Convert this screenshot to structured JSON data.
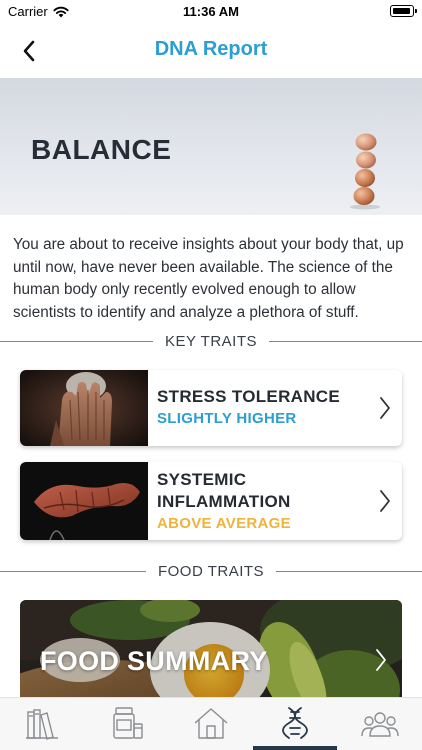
{
  "status": {
    "carrier": "Carrier",
    "time": "11:36 AM"
  },
  "nav": {
    "title": "DNA Report"
  },
  "hero": {
    "title": "BALANCE"
  },
  "intro_text": "You are about to receive insights about your body that, up until now, have never been available. The science of the human body only recently evolved enough to allow scientists to identify and analyze a plethora of stuff.",
  "sections": {
    "key_traits": "KEY TRAITS",
    "food_traits": "FOOD TRAITS"
  },
  "traits": [
    {
      "name": "STRESS TOLERANCE",
      "value": "SLIGHTLY HIGHER",
      "value_color": "#2b9fd2",
      "image": "hands-over-face"
    },
    {
      "name": "SYSTEMIC INFLAMMATION",
      "value": "ABOVE AVERAGE",
      "value_color": "#f0b33c",
      "image": "clasped-hands"
    }
  ],
  "food_card": {
    "title": "FOOD SUMMARY",
    "image": "avocado-egg-toast"
  },
  "tabs": [
    {
      "icon": "books-icon",
      "active": false
    },
    {
      "icon": "supplements-icon",
      "active": false
    },
    {
      "icon": "home-icon",
      "active": false
    },
    {
      "icon": "dna-icon",
      "active": true
    },
    {
      "icon": "community-icon",
      "active": false
    }
  ],
  "colors": {
    "accent": "#2b9fd2",
    "warning": "#f0b33c",
    "tab_indicator": "#24384a",
    "tab_icon": "#8a8d92"
  }
}
